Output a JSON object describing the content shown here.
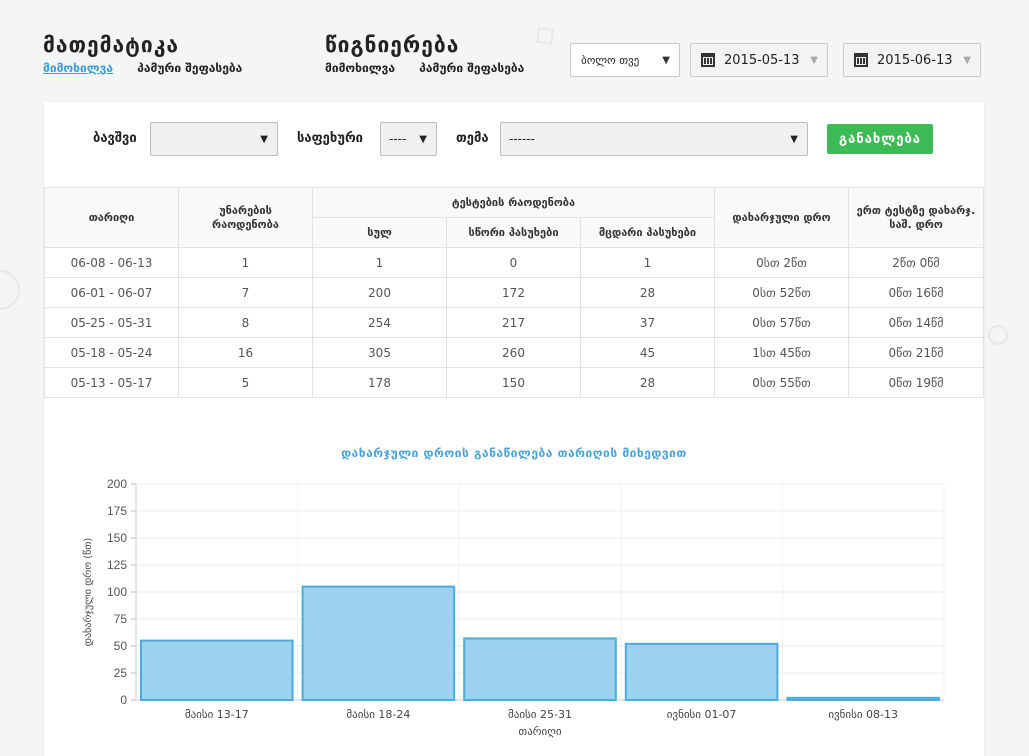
{
  "header": {
    "subjects": [
      {
        "title": "მათემატიკა",
        "links": [
          "მიმოხილვა",
          "პამური შეფასება"
        ],
        "active": 0
      },
      {
        "title": "წიგნიერება",
        "links": [
          "მიმოხილვა",
          "პამური შეფასება"
        ],
        "active": -1
      }
    ],
    "period_select": "ბოლო თვე",
    "date_from": "2015-05-13",
    "date_to": "2015-06-13"
  },
  "filters": {
    "student_label": "ბავშვი",
    "student_value": "",
    "level_label": "საფეხური",
    "level_value": "----",
    "topic_label": "თემა",
    "topic_value": "------",
    "refresh_label": "განახლება"
  },
  "table": {
    "h_date": "თარიღი",
    "h_skills": "უნარების რაოდენობა",
    "h_tests": "ტესტების რაოდენობა",
    "h_total": "სულ",
    "h_correct": "სწორი პასუხები",
    "h_wrong": "მცდარი პასუხები",
    "h_time": "დახარჯული დრო",
    "h_per_test": "ერთ ტესტზე დახარჯ. საშ. დრო",
    "rows": [
      {
        "date": "06-08 - 06-13",
        "skills": "1",
        "total": "1",
        "correct": "0",
        "wrong": "1",
        "time": "0სთ 2წთ",
        "per_test": "2წთ 0წმ"
      },
      {
        "date": "06-01 - 06-07",
        "skills": "7",
        "total": "200",
        "correct": "172",
        "wrong": "28",
        "time": "0სთ 52წთ",
        "per_test": "0წთ 16წმ"
      },
      {
        "date": "05-25 - 05-31",
        "skills": "8",
        "total": "254",
        "correct": "217",
        "wrong": "37",
        "time": "0სთ 57წთ",
        "per_test": "0წთ 14წმ"
      },
      {
        "date": "05-18 - 05-24",
        "skills": "16",
        "total": "305",
        "correct": "260",
        "wrong": "45",
        "time": "1სთ 45წთ",
        "per_test": "0წთ 21წმ"
      },
      {
        "date": "05-13 - 05-17",
        "skills": "5",
        "total": "178",
        "correct": "150",
        "wrong": "28",
        "time": "0სთ 55წთ",
        "per_test": "0წთ 19წმ"
      }
    ]
  },
  "chart_title": "დახარჯული დროის განაწილება თარიღის მიხედვით",
  "chart_data": {
    "type": "bar",
    "title": "დახარჯული დროის განაწილება თარიღის მიხედვით",
    "xlabel": "თარიღი",
    "ylabel": "დახარჯული დრო (წთ)",
    "categories": [
      "მაისი 13-17",
      "მაისი 18-24",
      "მაისი 25-31",
      "ივნისი 01-07",
      "ივნისი 08-13"
    ],
    "values": [
      55,
      105,
      57,
      52,
      2
    ],
    "ylim": [
      0,
      200
    ],
    "yticks": [
      0,
      25,
      50,
      75,
      100,
      125,
      150,
      175,
      200
    ],
    "grid": true,
    "bar_color": "#9cd1ef",
    "bar_edge": "#4aaddb"
  },
  "colors": {
    "accent": "#3a9dd6",
    "button": "#3dbb55"
  }
}
